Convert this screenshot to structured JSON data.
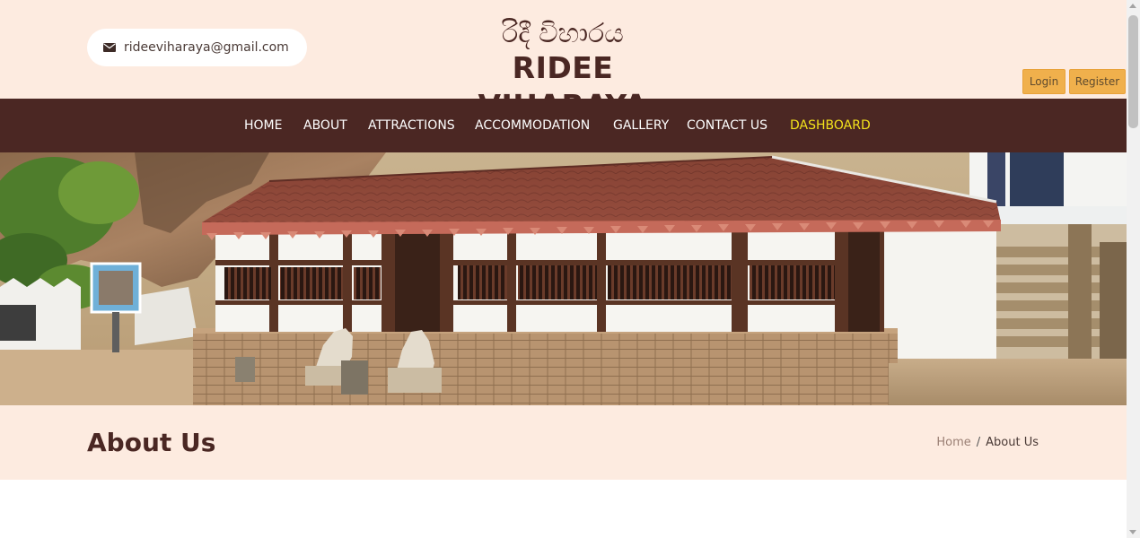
{
  "header": {
    "email": "rideeviharaya@gmail.com",
    "email_icon": "envelope-icon",
    "logo_sinhala": "රිදී විහාරය",
    "logo_english": "RIDEE VIHARAYA",
    "login_label": "Login",
    "register_label": "Register"
  },
  "nav": {
    "items": [
      {
        "label": "HOME"
      },
      {
        "label": "ABOUT"
      },
      {
        "label": "ATTRACTIONS"
      },
      {
        "label": "ACCOMMODATION"
      },
      {
        "label": "GALLERY"
      },
      {
        "label": "CONTACT US"
      },
      {
        "label": "DASHBOARD"
      }
    ]
  },
  "page": {
    "title": "About Us",
    "breadcrumb": {
      "home": "Home",
      "separator": "/",
      "current": "About Us"
    }
  },
  "colors": {
    "header_bg": "#fdebe0",
    "nav_bg": "#4b2723",
    "nav_active": "#f3e21c",
    "brand_text": "#4a2723",
    "button_bg": "#f0b04c"
  }
}
